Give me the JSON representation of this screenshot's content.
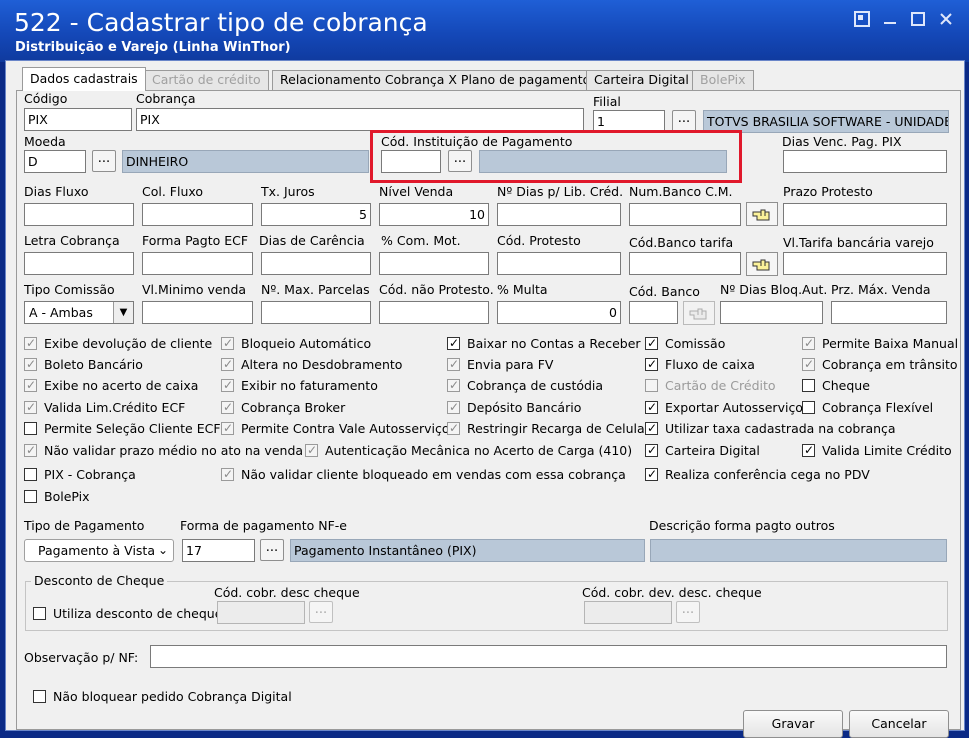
{
  "window": {
    "title": "522 - Cadastrar tipo de cobrança",
    "subtitle": "Distribuição e Varejo (Linha WinThor)"
  },
  "tabs": [
    {
      "label": "Dados cadastrais",
      "state": "active"
    },
    {
      "label": "Cartão de crédito",
      "state": "disabled"
    },
    {
      "label": "Relacionamento Cobrança X Plano de pagamento",
      "state": "normal"
    },
    {
      "label": "Carteira Digital",
      "state": "normal"
    },
    {
      "label": "BolePix",
      "state": "disabled"
    }
  ],
  "labels": {
    "codigo": "Código",
    "cobranca": "Cobrança",
    "filial": "Filial",
    "moeda": "Moeda",
    "cod_instituicao": "Cód. Instituição de Pagamento",
    "dias_venc_pix": "Dias Venc. Pag. PIX",
    "dias_fluxo": "Dias Fluxo",
    "col_fluxo": "Col. Fluxo",
    "tx_juros": "Tx. Juros",
    "nivel_venda": "Nível Venda",
    "n_dias_lib": "Nº Dias p/ Lib. Créd.",
    "num_banco_cm": "Num.Banco C.M.",
    "prazo_protesto": "Prazo Protesto",
    "letra_cobranca": "Letra Cobrança",
    "forma_pagto_ecf": "Forma Pagto ECF",
    "dias_carencia": "Dias de Carência",
    "com_mot": "% Com. Mot.",
    "cod_protesto": "Cód. Protesto",
    "cod_banco_tarifa": "Cód.Banco tarifa",
    "vl_tarifa": "Vl.Tarifa bancária varejo",
    "tipo_comissao": "Tipo Comissão",
    "vl_minimo": "Vl.Minimo venda",
    "n_max_parcelas": "Nº. Max. Parcelas",
    "cod_nao_protesto": "Cód. não Protesto.",
    "multa": "% Multa",
    "cod_banco": "Cód. Banco",
    "n_dias_bloq": "Nº Dias Bloq.Aut.",
    "prz_max_venda": "Prz. Máx. Venda",
    "tipo_pagamento": "Tipo de Pagamento",
    "forma_pagamento_nfe": "Forma de pagamento NF-e",
    "descricao_forma": "Descrição forma pagto outros",
    "desconto_cheque": "Desconto de Cheque",
    "cod_cobr_desc": "Cód. cobr. desc cheque",
    "cod_cobr_dev": "Cód. cobr. dev. desc. cheque",
    "observacao": "Observação p/ NF:"
  },
  "values": {
    "codigo": "PIX",
    "cobranca": "PIX",
    "filial": "1",
    "filial_desc": "TOTVS BRASILIA SOFTWARE - UNIDADE",
    "moeda": "D",
    "moeda_desc": "DINHEIRO",
    "tx_juros": "5",
    "nivel_venda": "10",
    "tipo_comissao": "A - Ambas",
    "multa": "0",
    "tipo_pagamento": "Pagamento à Vista",
    "forma_pagamento_nfe": "17",
    "forma_pagamento_desc": "Pagamento Instantâneo (PIX)"
  },
  "browse_glyph": "...",
  "checkboxes": {
    "col1": [
      {
        "label": "Exibe devolução de cliente",
        "checked": true,
        "style": "gray"
      },
      {
        "label": "Boleto Bancário",
        "checked": true,
        "style": "gray"
      },
      {
        "label": "Exibe no acerto de caixa",
        "checked": true,
        "style": "gray"
      },
      {
        "label": "Valida Lim.Crédito ECF",
        "checked": true,
        "style": "gray"
      },
      {
        "label": "Permite Seleção Cliente ECF",
        "checked": false,
        "style": "normal"
      },
      {
        "label": "Não validar prazo médio no ato na venda",
        "checked": true,
        "style": "gray"
      },
      {
        "label": "PIX - Cobrança",
        "checked": false,
        "style": "normal"
      },
      {
        "label": "BolePix",
        "checked": false,
        "style": "normal"
      }
    ],
    "col2": [
      {
        "label": "Bloqueio Automático",
        "checked": true,
        "style": "gray"
      },
      {
        "label": "Altera no Desdobramento",
        "checked": true,
        "style": "gray"
      },
      {
        "label": "Exibir no faturamento",
        "checked": true,
        "style": "gray"
      },
      {
        "label": "Cobrança Broker",
        "checked": true,
        "style": "gray"
      },
      {
        "label": "Permite Contra Vale Autosserviço",
        "checked": true,
        "style": "gray"
      },
      {
        "label": "Autenticação Mecânica no Acerto de Carga (410)",
        "checked": true,
        "style": "gray"
      },
      {
        "label": "Não validar cliente bloqueado em vendas com essa cobrança",
        "checked": true,
        "style": "gray"
      }
    ],
    "col3": [
      {
        "label": "Baixar no Contas a Receber",
        "checked": true,
        "style": "normal"
      },
      {
        "label": "Envia para FV",
        "checked": true,
        "style": "gray"
      },
      {
        "label": "Cobrança de custódia",
        "checked": true,
        "style": "gray"
      },
      {
        "label": "Depósito Bancário",
        "checked": true,
        "style": "gray"
      },
      {
        "label": "Restringir Recarga de Celular",
        "checked": true,
        "style": "gray"
      }
    ],
    "col4": [
      {
        "label": "Comissão",
        "checked": true,
        "style": "normal"
      },
      {
        "label": "Fluxo de caixa",
        "checked": true,
        "style": "normal"
      },
      {
        "label": "Cartão de Crédito",
        "checked": false,
        "style": "disabled"
      },
      {
        "label": "Exportar Autosserviço",
        "checked": true,
        "style": "normal"
      },
      {
        "label": "Utilizar taxa cadastrada na cobrança",
        "checked": true,
        "style": "normal"
      },
      {
        "label": "Carteira Digital",
        "checked": true,
        "style": "normal"
      },
      {
        "label": "Realiza conferência cega no PDV",
        "checked": true,
        "style": "normal"
      }
    ],
    "col5": [
      {
        "label": "Permite Baixa Manual",
        "checked": true,
        "style": "gray"
      },
      {
        "label": "Cobrança em trânsito",
        "checked": true,
        "style": "gray"
      },
      {
        "label": "Cheque",
        "checked": false,
        "style": "normal"
      },
      {
        "label": "Cobrança Flexível",
        "checked": false,
        "style": "normal"
      },
      {
        "label": "Valida Limite Crédito",
        "checked": true,
        "style": "normal"
      }
    ],
    "utiliza_desconto": {
      "label": "Utiliza desconto de cheque",
      "checked": false
    },
    "nao_bloquear": {
      "label": "Não bloquear pedido Cobrança Digital",
      "checked": false
    }
  },
  "buttons": {
    "gravar": "Gravar",
    "cancelar": "Cancelar"
  },
  "colors": {
    "titlebar": "#1448b8",
    "readonly_field": "#b9c8d8",
    "highlight": "#e0182b"
  }
}
